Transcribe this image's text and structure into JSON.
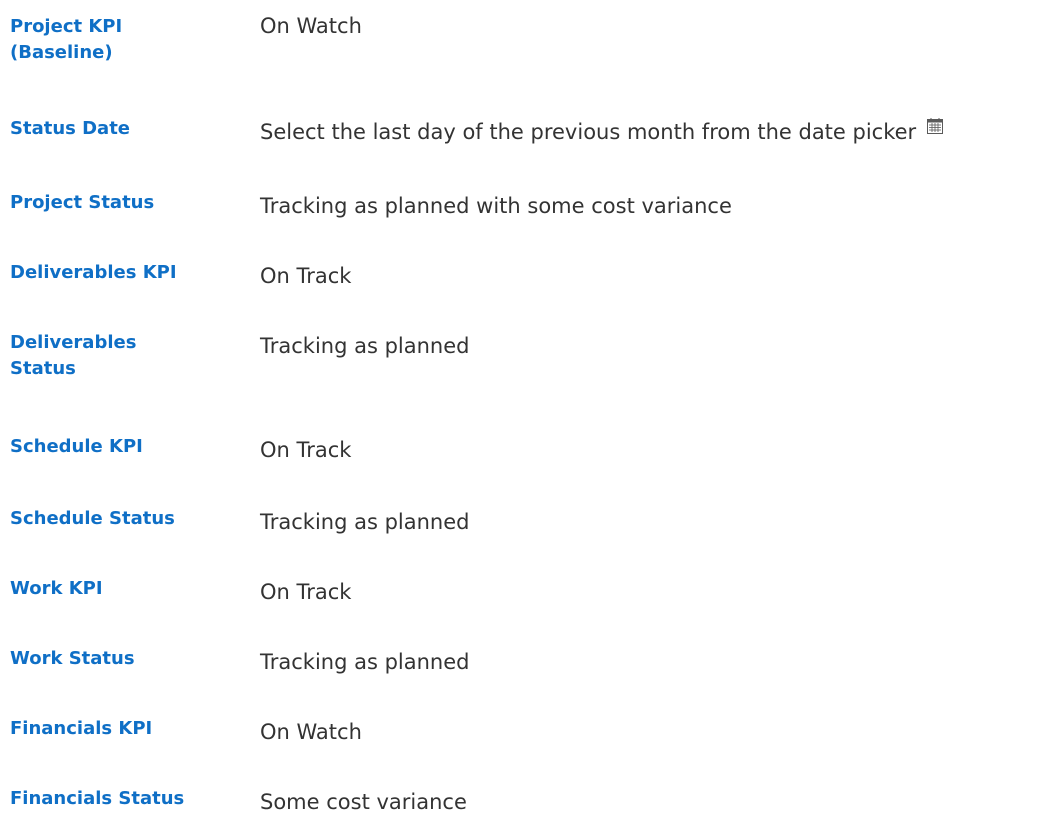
{
  "fields": [
    {
      "label_line1": "Project KPI",
      "label_line2": "(Baseline)",
      "value": "On Watch"
    },
    {
      "label": "Status Date",
      "value": "Select the last day of the previous month from the date picker",
      "icon": "calendar-icon"
    },
    {
      "label": "Project Status",
      "value": "Tracking as planned with some cost variance"
    },
    {
      "label": "Deliverables KPI",
      "value": "On Track"
    },
    {
      "label_line1": "Deliverables",
      "label_line2": "Status",
      "value": "Tracking as planned"
    },
    {
      "label": "Schedule KPI",
      "value": "On Track"
    },
    {
      "label": "Schedule Status",
      "value": "Tracking as planned"
    },
    {
      "label": "Work KPI",
      "value": "On Track"
    },
    {
      "label": "Work Status",
      "value": "Tracking as planned"
    },
    {
      "label": "Financials KPI",
      "value": "On Watch"
    },
    {
      "label": "Financials Status",
      "value": "Some cost variance"
    }
  ]
}
